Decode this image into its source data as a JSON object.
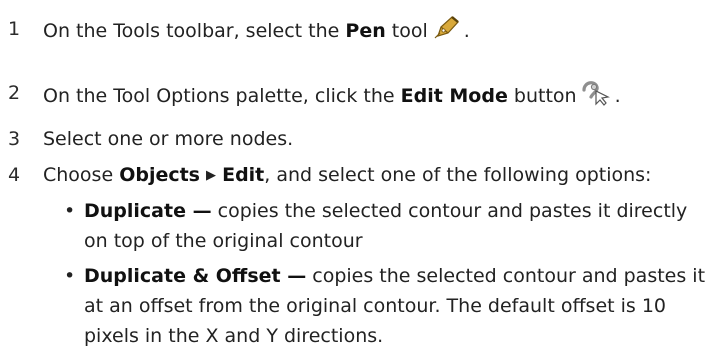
{
  "steps": [
    {
      "number": "1",
      "text_before": "On the Tools toolbar, select the ",
      "bold": "Pen",
      "text_after": " tool",
      "end": ".",
      "icon": "pen-tool-icon"
    },
    {
      "number": "2",
      "text_before": "On the Tool Options palette, click the ",
      "bold": "Edit Mode",
      "text_after": " button",
      "end": ".",
      "icon": "edit-mode-icon"
    },
    {
      "number": "3",
      "text": "Select one or more nodes."
    },
    {
      "number": "4",
      "text_before": "Choose ",
      "bold_a": "Objects",
      "arrow": "▶",
      "bold_b": "Edit",
      "text_after": ", and select one of the following options:"
    }
  ],
  "options": [
    {
      "bullet": "•",
      "term": "Duplicate —",
      "line1": " copies the selected contour and pastes it directly",
      "line2": "on top of the original contour"
    },
    {
      "bullet": "•",
      "term": "Duplicate & Offset —",
      "line1": " copies the selected contour and pastes it",
      "line2": "at an offset from the original contour. The default offset is 10",
      "line3": "pixels in the X and Y directions."
    }
  ],
  "colors": {
    "text": "#222222",
    "pen_icon": "#c99a2e",
    "edit_mode_icon": "#9a9a9a"
  }
}
